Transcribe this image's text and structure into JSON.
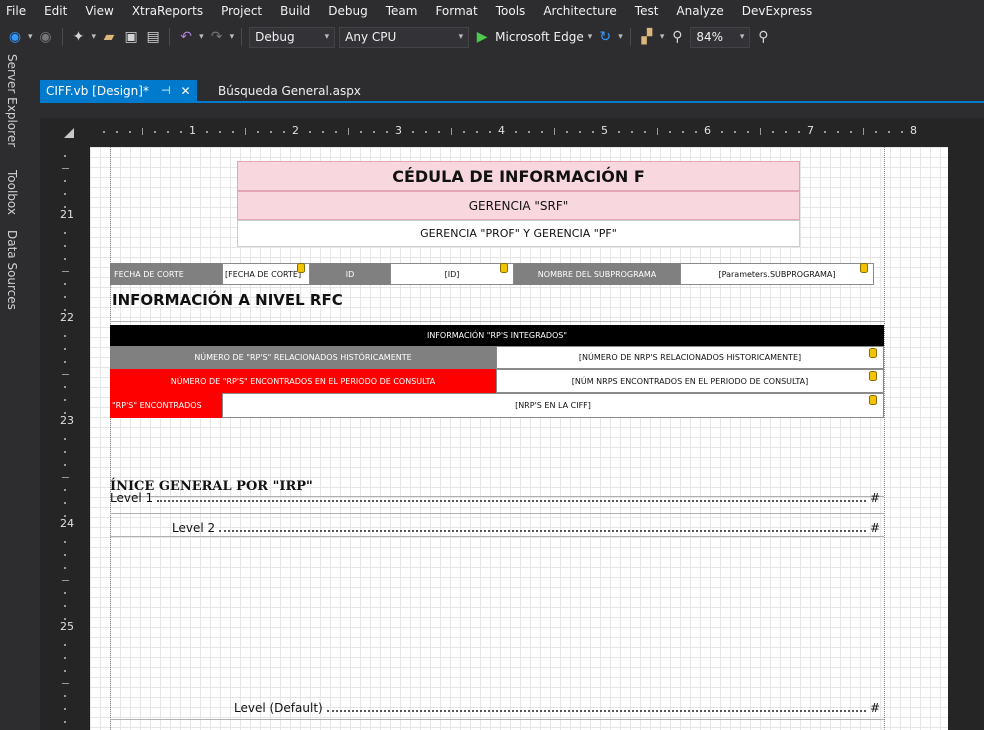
{
  "menu": [
    "File",
    "Edit",
    "View",
    "XtraReports",
    "Project",
    "Build",
    "Debug",
    "Team",
    "Format",
    "Tools",
    "Architecture",
    "Test",
    "Analyze",
    "DevExpress"
  ],
  "toolbar": {
    "config": "Debug",
    "platform": "Any CPU",
    "run_target": "Microsoft Edge",
    "zoom": "84%"
  },
  "side_tabs": [
    "Server Explorer",
    "Toolbox",
    "Data Sources"
  ],
  "tabs": {
    "active": "CIFF.vb [Design]*",
    "inactive": "Búsqueda General.aspx"
  },
  "ruler": {
    "h_numbers": [
      "1",
      "2",
      "3",
      "4",
      "5",
      "6",
      "7",
      "8"
    ],
    "v_numbers": [
      "21",
      "22",
      "23",
      "24",
      "25"
    ]
  },
  "report": {
    "title": "CÉDULA DE INFORMACIÓN F",
    "subtitle": "GERENCIA \"SRF\"",
    "subtitle2": "GERENCIA \"PROF\" Y  GERENCIA \"PF\"",
    "row1": {
      "fecha_label": "FECHA DE CORTE",
      "fecha_value": "[FECHA DE CORTE]",
      "id_label": "ID",
      "id_value": "[ID]",
      "subprog_label": "NOMBRE DEL SUBPROGRAMA",
      "subprog_value": "[Parameters.SUBPROGRAMA]"
    },
    "section_heading": "INFORMACIÓN A NIVEL RFC",
    "table_header": "INFORMACIÓN \"RP'S INTEGRADOS\"",
    "rows": [
      {
        "label": "NÚMERO DE \"RP'S\"  RELACIONADOS HISTÓRICAMENTE",
        "value": "[NÚMERO DE NRP'S RELACIONADOS HISTORICAMENTE]"
      },
      {
        "label": "NÚMERO DE \"RP'S\" ENCONTRADOS EN EL PERIODO DE CONSULTA",
        "value": "[NÚM NRPS ENCONTRADOS EN EL PERIODO DE CONSULTA]"
      },
      {
        "label": "\"RP'S\" ENCONTRADOS",
        "value": "[NRP'S EN LA CIFF]"
      }
    ],
    "index_heading": "ÍNICE GENERAL POR \"IRP\"",
    "toc": [
      {
        "label": "Level  1",
        "page": "#"
      },
      {
        "label": "Level  2",
        "page": "#"
      },
      {
        "label": "Level  (Default)",
        "page": "#"
      }
    ]
  }
}
